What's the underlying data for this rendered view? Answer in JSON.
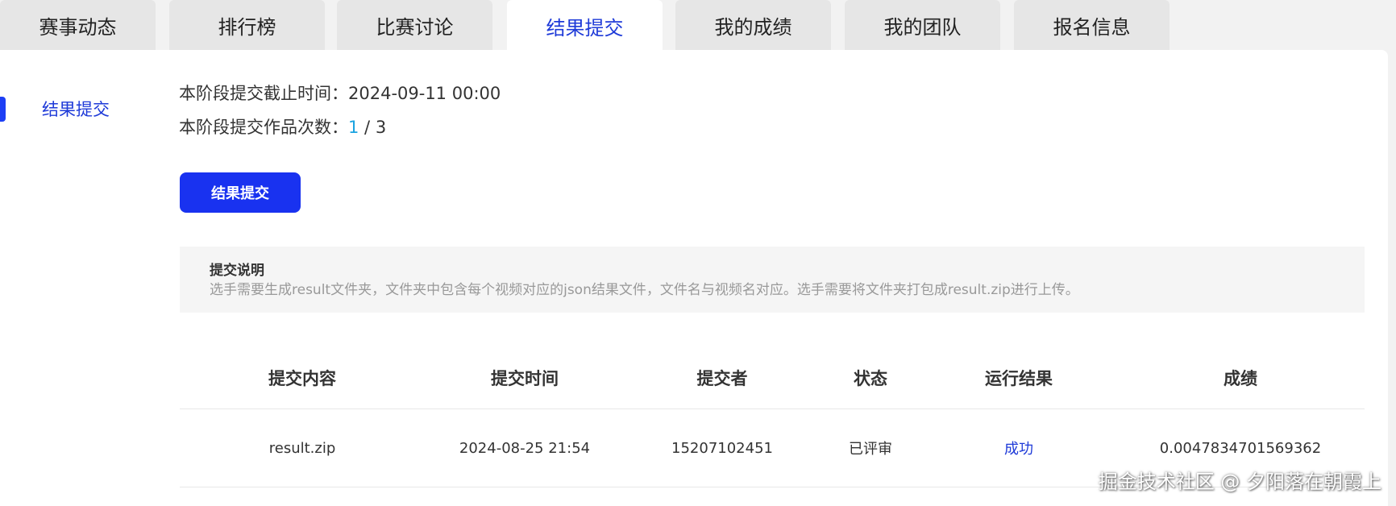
{
  "tabs": [
    {
      "label": "赛事动态",
      "active": false
    },
    {
      "label": "排行榜",
      "active": false
    },
    {
      "label": "比赛讨论",
      "active": false
    },
    {
      "label": "结果提交",
      "active": true
    },
    {
      "label": "我的成绩",
      "active": false
    },
    {
      "label": "我的团队",
      "active": false
    },
    {
      "label": "报名信息",
      "active": false
    }
  ],
  "sidebar": {
    "items": [
      {
        "label": "结果提交",
        "active": true
      }
    ]
  },
  "info": {
    "deadline_label": "本阶段提交截止时间：",
    "deadline_value": "2024-09-11 00:00",
    "count_label": "本阶段提交作品次数：",
    "count_used": "1",
    "count_sep": " / ",
    "count_total": "3"
  },
  "submit_button": {
    "label": "结果提交"
  },
  "note": {
    "title": "提交说明",
    "text": "选手需要生成result文件夹，文件夹中包含每个视频对应的json结果文件，文件名与视频名对应。选手需要将文件夹打包成result.zip进行上传。"
  },
  "table": {
    "headers": [
      "提交内容",
      "提交时间",
      "提交者",
      "状态",
      "运行结果",
      "成绩"
    ],
    "rows": [
      [
        "result.zip",
        "2024-08-25 21:54",
        "15207102451",
        "已评审",
        "成功",
        "0.0047834701569362"
      ]
    ]
  },
  "watermark": "掘金技术社区 @ 夕阳落在朝霞上",
  "colors": {
    "accent": "#1e3ad8",
    "button": "#1932f0",
    "count_used": "#1aa3e0"
  }
}
